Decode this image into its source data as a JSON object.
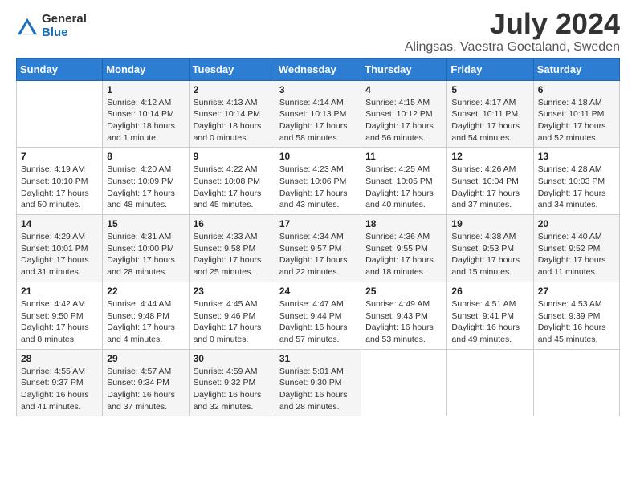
{
  "logo": {
    "general": "General",
    "blue": "Blue"
  },
  "title": {
    "month_year": "July 2024",
    "location": "Alingsas, Vaestra Goetaland, Sweden"
  },
  "weekdays": [
    "Sunday",
    "Monday",
    "Tuesday",
    "Wednesday",
    "Thursday",
    "Friday",
    "Saturday"
  ],
  "weeks": [
    [
      {
        "day": "",
        "info": ""
      },
      {
        "day": "1",
        "info": "Sunrise: 4:12 AM\nSunset: 10:14 PM\nDaylight: 18 hours\nand 1 minute."
      },
      {
        "day": "2",
        "info": "Sunrise: 4:13 AM\nSunset: 10:14 PM\nDaylight: 18 hours\nand 0 minutes."
      },
      {
        "day": "3",
        "info": "Sunrise: 4:14 AM\nSunset: 10:13 PM\nDaylight: 17 hours\nand 58 minutes."
      },
      {
        "day": "4",
        "info": "Sunrise: 4:15 AM\nSunset: 10:12 PM\nDaylight: 17 hours\nand 56 minutes."
      },
      {
        "day": "5",
        "info": "Sunrise: 4:17 AM\nSunset: 10:11 PM\nDaylight: 17 hours\nand 54 minutes."
      },
      {
        "day": "6",
        "info": "Sunrise: 4:18 AM\nSunset: 10:11 PM\nDaylight: 17 hours\nand 52 minutes."
      }
    ],
    [
      {
        "day": "7",
        "info": "Sunrise: 4:19 AM\nSunset: 10:10 PM\nDaylight: 17 hours\nand 50 minutes."
      },
      {
        "day": "8",
        "info": "Sunrise: 4:20 AM\nSunset: 10:09 PM\nDaylight: 17 hours\nand 48 minutes."
      },
      {
        "day": "9",
        "info": "Sunrise: 4:22 AM\nSunset: 10:08 PM\nDaylight: 17 hours\nand 45 minutes."
      },
      {
        "day": "10",
        "info": "Sunrise: 4:23 AM\nSunset: 10:06 PM\nDaylight: 17 hours\nand 43 minutes."
      },
      {
        "day": "11",
        "info": "Sunrise: 4:25 AM\nSunset: 10:05 PM\nDaylight: 17 hours\nand 40 minutes."
      },
      {
        "day": "12",
        "info": "Sunrise: 4:26 AM\nSunset: 10:04 PM\nDaylight: 17 hours\nand 37 minutes."
      },
      {
        "day": "13",
        "info": "Sunrise: 4:28 AM\nSunset: 10:03 PM\nDaylight: 17 hours\nand 34 minutes."
      }
    ],
    [
      {
        "day": "14",
        "info": "Sunrise: 4:29 AM\nSunset: 10:01 PM\nDaylight: 17 hours\nand 31 minutes."
      },
      {
        "day": "15",
        "info": "Sunrise: 4:31 AM\nSunset: 10:00 PM\nDaylight: 17 hours\nand 28 minutes."
      },
      {
        "day": "16",
        "info": "Sunrise: 4:33 AM\nSunset: 9:58 PM\nDaylight: 17 hours\nand 25 minutes."
      },
      {
        "day": "17",
        "info": "Sunrise: 4:34 AM\nSunset: 9:57 PM\nDaylight: 17 hours\nand 22 minutes."
      },
      {
        "day": "18",
        "info": "Sunrise: 4:36 AM\nSunset: 9:55 PM\nDaylight: 17 hours\nand 18 minutes."
      },
      {
        "day": "19",
        "info": "Sunrise: 4:38 AM\nSunset: 9:53 PM\nDaylight: 17 hours\nand 15 minutes."
      },
      {
        "day": "20",
        "info": "Sunrise: 4:40 AM\nSunset: 9:52 PM\nDaylight: 17 hours\nand 11 minutes."
      }
    ],
    [
      {
        "day": "21",
        "info": "Sunrise: 4:42 AM\nSunset: 9:50 PM\nDaylight: 17 hours\nand 8 minutes."
      },
      {
        "day": "22",
        "info": "Sunrise: 4:44 AM\nSunset: 9:48 PM\nDaylight: 17 hours\nand 4 minutes."
      },
      {
        "day": "23",
        "info": "Sunrise: 4:45 AM\nSunset: 9:46 PM\nDaylight: 17 hours\nand 0 minutes."
      },
      {
        "day": "24",
        "info": "Sunrise: 4:47 AM\nSunset: 9:44 PM\nDaylight: 16 hours\nand 57 minutes."
      },
      {
        "day": "25",
        "info": "Sunrise: 4:49 AM\nSunset: 9:43 PM\nDaylight: 16 hours\nand 53 minutes."
      },
      {
        "day": "26",
        "info": "Sunrise: 4:51 AM\nSunset: 9:41 PM\nDaylight: 16 hours\nand 49 minutes."
      },
      {
        "day": "27",
        "info": "Sunrise: 4:53 AM\nSunset: 9:39 PM\nDaylight: 16 hours\nand 45 minutes."
      }
    ],
    [
      {
        "day": "28",
        "info": "Sunrise: 4:55 AM\nSunset: 9:37 PM\nDaylight: 16 hours\nand 41 minutes."
      },
      {
        "day": "29",
        "info": "Sunrise: 4:57 AM\nSunset: 9:34 PM\nDaylight: 16 hours\nand 37 minutes."
      },
      {
        "day": "30",
        "info": "Sunrise: 4:59 AM\nSunset: 9:32 PM\nDaylight: 16 hours\nand 32 minutes."
      },
      {
        "day": "31",
        "info": "Sunrise: 5:01 AM\nSunset: 9:30 PM\nDaylight: 16 hours\nand 28 minutes."
      },
      {
        "day": "",
        "info": ""
      },
      {
        "day": "",
        "info": ""
      },
      {
        "day": "",
        "info": ""
      }
    ]
  ]
}
